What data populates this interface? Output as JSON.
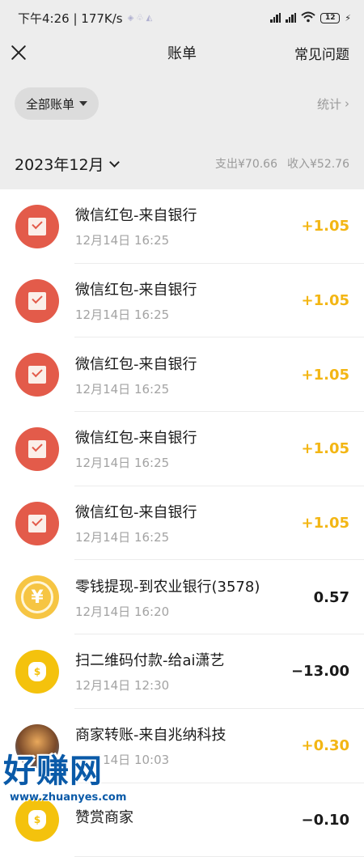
{
  "status_bar": {
    "time_speed": "下午4:26 | 177K/s",
    "battery": "12"
  },
  "header": {
    "title": "账单",
    "faq_label": "常见问题"
  },
  "filter": {
    "scope_label": "全部账单",
    "stats_label": "统计",
    "stats_chevron": "›"
  },
  "period": {
    "month": "2023年12月",
    "expense": "支出¥70.66",
    "income": "收入¥52.76"
  },
  "transactions": [
    {
      "title": "微信红包-来自银行",
      "time": "12月14日 16:25",
      "amount": "+1.05",
      "icon": "red-packet-icon"
    },
    {
      "title": "微信红包-来自银行",
      "time": "12月14日 16:25",
      "amount": "+1.05",
      "icon": "red-packet-icon"
    },
    {
      "title": "微信红包-来自银行",
      "time": "12月14日 16:25",
      "amount": "+1.05",
      "icon": "red-packet-icon"
    },
    {
      "title": "微信红包-来自银行",
      "time": "12月14日 16:25",
      "amount": "+1.05",
      "icon": "red-packet-icon"
    },
    {
      "title": "微信红包-来自银行",
      "time": "12月14日 16:25",
      "amount": "+1.05",
      "icon": "red-packet-icon"
    },
    {
      "title": "零钱提现-到农业银行(3578)",
      "time": "12月14日 16:20",
      "amount": "0.57",
      "icon": "yuan-coin-icon",
      "coin_glyph": "¥"
    },
    {
      "title": "扫二维码付款-给ai潇艺",
      "time": "12月14日 12:30",
      "amount": "−13.00",
      "icon": "money-bag-icon",
      "bag_glyph": "$"
    },
    {
      "title": "商家转账-来自兆纳科技",
      "time": "12月14日 10:03",
      "amount": "+0.30",
      "icon": "merchant-avatar-icon"
    },
    {
      "title": "赞赏商家",
      "time": "",
      "amount": "−0.10",
      "icon": "money-bag-icon",
      "bag_glyph": "$"
    }
  ],
  "watermark": {
    "brand": "好赚网",
    "url": "www.zhuanyes.com"
  }
}
